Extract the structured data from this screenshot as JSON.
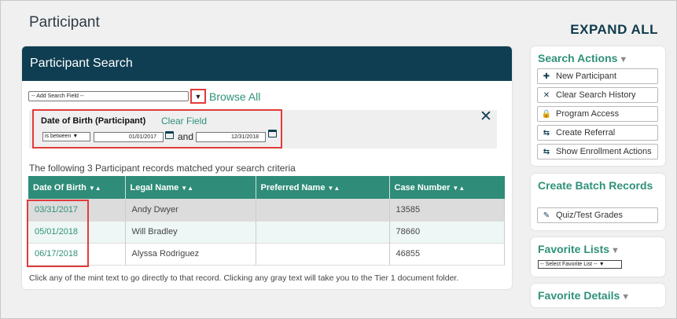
{
  "page": {
    "title": "Participant",
    "expand_all": "EXPAND ALL"
  },
  "search_panel": {
    "header": "Participant Search",
    "add_field_placeholder": "-- Add Search Field --",
    "browse_all": "Browse All",
    "criteria": {
      "label": "Date of Birth (Participant)",
      "clear_field": "Clear Field",
      "operator": "is between",
      "from": "01/01/2017",
      "and": "and",
      "to": "12/31/2018"
    },
    "results_message": "The following 3 Participant records matched your search criteria",
    "columns": [
      "Date Of Birth",
      "Legal Name",
      "Preferred Name",
      "Case Number"
    ],
    "rows": [
      {
        "dob": "03/31/2017",
        "legal_name": "Andy Dwyer",
        "preferred_name": "",
        "case_number": "13585"
      },
      {
        "dob": "05/01/2018",
        "legal_name": "Will Bradley",
        "preferred_name": "",
        "case_number": "78660"
      },
      {
        "dob": "06/17/2018",
        "legal_name": "Alyssa Rodriguez",
        "preferred_name": "",
        "case_number": "46855"
      }
    ],
    "footer_note": "Click any of the mint text to go directly to that record. Clicking any gray text will take you to the Tier 1 document folder."
  },
  "sidebar": {
    "search_actions": {
      "title": "Search Actions",
      "items": [
        "New Participant",
        "Clear Search History",
        "Program Access",
        "Create Referral",
        "Show Enrollment Actions"
      ]
    },
    "batch_records": {
      "title": "Create Batch Records",
      "items": [
        "Quiz/Test Grades"
      ]
    },
    "favorite_lists": {
      "title": "Favorite Lists",
      "select_placeholder": "-- Select Favorite List --"
    },
    "favorite_details": {
      "title": "Favorite Details"
    }
  },
  "colors": {
    "header_bg": "#0f3e52",
    "table_header": "#2e8c78",
    "mint": "#2f9179",
    "highlight": "#e23b3b"
  }
}
